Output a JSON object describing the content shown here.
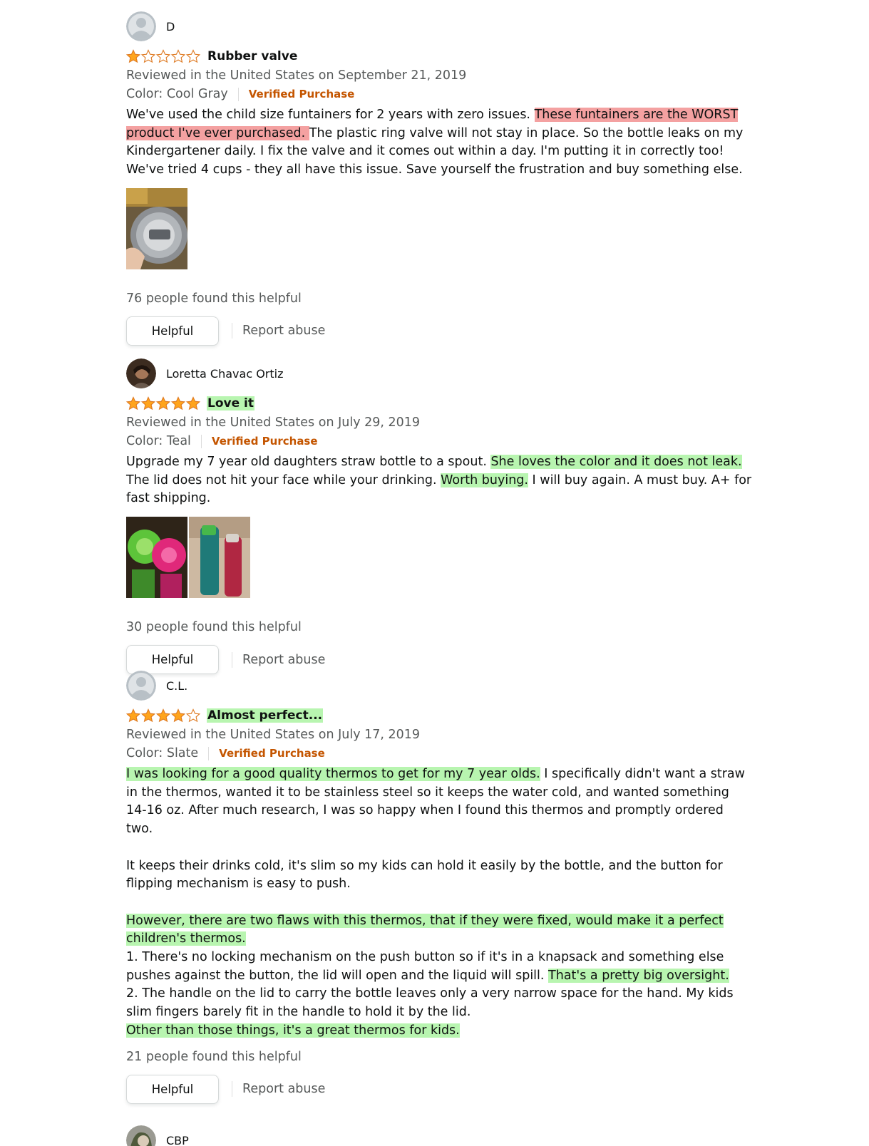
{
  "reviews": [
    {
      "name": "D",
      "avatar": "default-avatar",
      "rating": 1,
      "title": "Rubber valve",
      "title_highlight": "",
      "date": "Reviewed in the United States on September 21, 2019",
      "color": "Color: Cool Gray",
      "verified": "Verified Purchase",
      "body": [
        [
          {
            "t": "We've used the child size funtainers for 2 years with zero issues. ",
            "h": ""
          },
          {
            "t": "These funtainers are the WORST product I've ever purchased. ",
            "h": "red"
          },
          {
            "t": "The plastic ring valve will not stay in place. So the bottle leaks on my Kindergartener daily. I fix the valve and it comes out within a day. I'm putting it in correctly too! We've tried 4 cups - they all have this issue. Save yourself the frustration and buy something else.",
            "h": ""
          }
        ]
      ],
      "helpful_count": "76 people found this helpful",
      "helpful_label": "Helpful",
      "report_label": "Report abuse"
    },
    {
      "name": "Loretta Chavac Ortiz",
      "avatar": "user-photo",
      "rating": 5,
      "title": "Love it",
      "title_highlight": "green",
      "date": "Reviewed in the United States on July 29, 2019",
      "color": "Color: Teal",
      "verified": "Verified Purchase",
      "body": [
        [
          {
            "t": "Upgrade my 7 year old daughters straw bottle to a spout. ",
            "h": ""
          },
          {
            "t": "She loves the color and it does not leak.",
            "h": "green"
          },
          {
            "t": " The lid does not hit your face while your drinking. ",
            "h": ""
          },
          {
            "t": "Worth buying.",
            "h": "green"
          },
          {
            "t": " I will buy again. A must buy. A+ for fast shipping.",
            "h": ""
          }
        ]
      ],
      "helpful_count": "30 people found this helpful",
      "helpful_label": "Helpful",
      "report_label": "Report abuse"
    },
    {
      "name": "C.L.",
      "avatar": "default-avatar",
      "rating": 4,
      "title": "Almost perfect...",
      "title_highlight": "green",
      "date": "Reviewed in the United States on July 17, 2019",
      "color": "Color: Slate",
      "verified": "Verified Purchase",
      "body": [
        [
          {
            "t": "I was looking for a good quality thermos to get for my 7 year olds.",
            "h": "green"
          },
          {
            "t": " I specifically didn't want a straw in the thermos, wanted it to be stainless steel so it keeps the water cold, and wanted something 14-16 oz. After much research, I was so happy when I found this thermos and promptly ordered two.",
            "h": ""
          }
        ],
        [],
        [
          {
            "t": "It keeps their drinks cold, it's slim so my kids can hold it easily by the bottle, and the button for flipping mechanism is easy to push.",
            "h": ""
          }
        ],
        [],
        [
          {
            "t": "However, there are two flaws with this thermos, that if they were fixed, would make it a perfect children's thermos.",
            "h": "green"
          }
        ],
        [
          {
            "t": "1. There's no locking mechanism on the push button so if it's in a knapsack and something else pushes against the button, the lid will open and the liquid will spill. ",
            "h": ""
          },
          {
            "t": "That's a pretty big oversight.",
            "h": "green"
          }
        ],
        [
          {
            "t": "2. The handle on the lid to carry the bottle leaves only a very narrow space for the hand. My kids slim fingers barely fit in the handle to hold it by the lid.",
            "h": ""
          }
        ],
        [
          {
            "t": "Other than those things, it's a great thermos for kids.",
            "h": "green"
          }
        ]
      ],
      "helpful_count": "21 people found this helpful",
      "helpful_label": "Helpful",
      "report_label": "Report abuse"
    },
    {
      "name": "CBP",
      "avatar": "user-photo"
    }
  ],
  "colors": {
    "star": "#ffa41c",
    "verified": "#c45500",
    "highlight_red": "#f4a1a1",
    "highlight_green": "#b8f5b0"
  }
}
